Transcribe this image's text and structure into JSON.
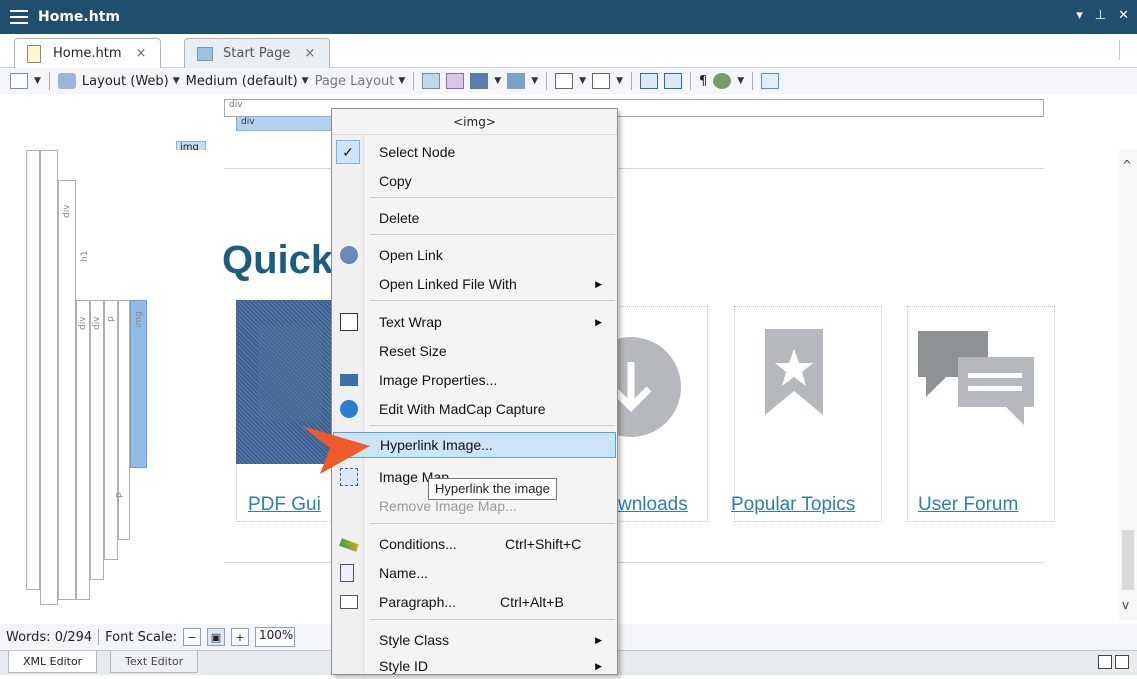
{
  "window": {
    "title": "Home.htm"
  },
  "tabs": [
    {
      "label": "Home.htm",
      "close": "×"
    },
    {
      "label": "Start Page",
      "close": "×"
    }
  ],
  "toolbar": {
    "layout_web": "Layout (Web)",
    "medium": "Medium (default)",
    "page_layout": "Page Layout"
  },
  "structure": {
    "div_outer": "div",
    "div_inner": "div",
    "img_tag": "img",
    "v_div": "div",
    "v_h1": "h1",
    "v_div2": "div",
    "v_div3": "div",
    "v_p": "p",
    "v_img": "img",
    "v_p2": "p"
  },
  "content": {
    "heading": "Quick",
    "cards": [
      {
        "label": "PDF Gui"
      },
      {
        "label": "wnloads"
      },
      {
        "label": "Popular Topics"
      },
      {
        "label": "User Forum"
      }
    ]
  },
  "context_menu": {
    "header": "<img>",
    "items": [
      {
        "label": "Select Node",
        "checked": true
      },
      {
        "label": "Copy"
      },
      {
        "label": "Delete"
      },
      {
        "label": "Open Link"
      },
      {
        "label": "Open Linked File With",
        "submenu": true
      },
      {
        "label": "Text Wrap",
        "submenu": true
      },
      {
        "label": "Reset Size"
      },
      {
        "label": "Image Properties..."
      },
      {
        "label": "Edit With MadCap Capture"
      },
      {
        "label": "Hyperlink Image...",
        "highlighted": true
      },
      {
        "label": "Image Map..."
      },
      {
        "label": "Remove Image Map...",
        "disabled": true
      },
      {
        "label": "Conditions...",
        "shortcut": "Ctrl+Shift+C"
      },
      {
        "label": "Name..."
      },
      {
        "label": "Paragraph...",
        "shortcut": "Ctrl+Alt+B"
      },
      {
        "label": "Style Class",
        "submenu": true
      },
      {
        "label": "Style ID",
        "submenu": true
      }
    ],
    "submenu_arrow": "▶",
    "check_mark": "✓"
  },
  "tooltip": "Hyperlink the image",
  "status": {
    "words": "Words: 0/294",
    "font_scale": "Font Scale:",
    "zoom": "100%"
  },
  "editor_tabs": [
    "XML Editor",
    "Text Editor"
  ],
  "colors": {
    "titlebar": "#1f4e6e",
    "heading": "#1c5d7c",
    "link": "#2c7fb2",
    "highlight": "#cce4f7",
    "arrow": "#f05a28"
  }
}
